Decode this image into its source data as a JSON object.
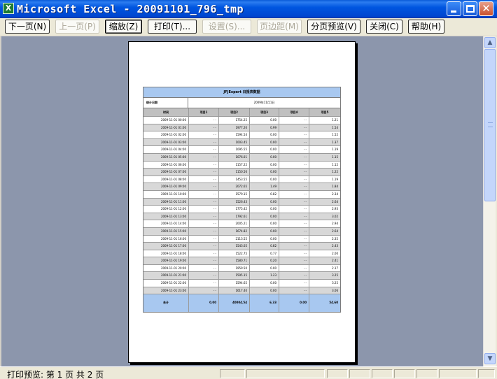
{
  "window": {
    "title": "Microsoft Excel - 20091101_796_tmp",
    "app_icon": "excel-icon",
    "controls": {
      "minimize": "minimize-icon",
      "maximize": "maximize-icon",
      "close": "✕"
    }
  },
  "toolbar": {
    "buttons": [
      {
        "label": "下一页(N)",
        "enabled": true
      },
      {
        "label": "上一页(P)",
        "enabled": false
      },
      {
        "label": "缩放(Z)",
        "enabled": true
      },
      {
        "label": "打印(T)...",
        "enabled": true
      },
      {
        "label": "设置(S)...",
        "enabled": false
      },
      {
        "label": "页边距(M)",
        "enabled": false
      },
      {
        "label": "分页预览(V)",
        "enabled": true
      },
      {
        "label": "关闭(C)",
        "enabled": true
      },
      {
        "label": "帮助(H)",
        "enabled": true
      }
    ]
  },
  "scrollbar": {
    "up": "▲",
    "down": "▼"
  },
  "report": {
    "title": "JFJExpert 日报表数据",
    "info_label": "统计日期",
    "info_value": "2009年11月1日",
    "headers": [
      "时间",
      "项目1",
      "项目2",
      "项目3",
      "项目4",
      "项目5"
    ],
    "rows": [
      [
        "2009-11-01 00:00",
        "- -",
        "1754.25",
        "0.00",
        "- -",
        "1.21"
      ],
      [
        "2009-11-01 01:00",
        "- -",
        "1977.20",
        "0.99",
        "- -",
        "1.54"
      ],
      [
        "2009-11-01 02:00",
        "- -",
        "1594.54",
        "0.00",
        "- -",
        "1.52"
      ],
      [
        "2009-11-01 03:00",
        "- -",
        "1003.45",
        "0.00",
        "- -",
        "1.37"
      ],
      [
        "2009-11-01 04:00",
        "- -",
        "1095.55",
        "0.00",
        "- -",
        "1.19"
      ],
      [
        "2009-11-01 05:00",
        "- -",
        "1076.01",
        "0.00",
        "- -",
        "1.15"
      ],
      [
        "2009-11-01 06:00",
        "- -",
        "1157.22",
        "0.00",
        "- -",
        "1.12"
      ],
      [
        "2009-11-01 07:00",
        "- -",
        "1150.56",
        "0.00",
        "- -",
        "1.22"
      ],
      [
        "2009-11-01 08:00",
        "- -",
        "1453.55",
        "0.00",
        "- -",
        "1.19"
      ],
      [
        "2009-11-01 09:00",
        "- -",
        "2072.65",
        "1.49",
        "- -",
        "1.84"
      ],
      [
        "2009-11-01 10:00",
        "- -",
        "1579.15",
        "0.82",
        "- -",
        "2.34"
      ],
      [
        "2009-11-01 11:00",
        "- -",
        "1526.43",
        "0.00",
        "- -",
        "2.64"
      ],
      [
        "2009-11-01 12:00",
        "- -",
        "1775.42",
        "0.00",
        "- -",
        "2.93"
      ],
      [
        "2009-11-01 13:00",
        "- -",
        "1792.61",
        "0.00",
        "- -",
        "3.02"
      ],
      [
        "2009-11-01 14:00",
        "- -",
        "2005.21",
        "0.00",
        "- -",
        "2.94"
      ],
      [
        "2009-11-01 15:00",
        "- -",
        "1674.82",
        "0.00",
        "- -",
        "2.64"
      ],
      [
        "2009-11-01 16:00",
        "- -",
        "2113.55",
        "0.00",
        "- -",
        "2.35"
      ],
      [
        "2009-11-01 17:00",
        "- -",
        "1543.05",
        "0.82",
        "- -",
        "2.43"
      ],
      [
        "2009-11-01 18:00",
        "- -",
        "1522.75",
        "0.77",
        "- -",
        "2.00"
      ],
      [
        "2009-11-01 19:00",
        "- -",
        "1580.71",
        "0.20",
        "- -",
        "2.41"
      ],
      [
        "2009-11-01 20:00",
        "- -",
        "1959.50",
        "0.00",
        "- -",
        "2.17"
      ],
      [
        "2009-11-01 21:00",
        "- -",
        "1595.15",
        "1.23",
        "- -",
        "3.25"
      ],
      [
        "2009-11-01 22:00",
        "- -",
        "1594.65",
        "0.00",
        "- -",
        "3.25"
      ],
      [
        "2009-11-01 23:00",
        "- -",
        "1617.40",
        "0.00",
        "- -",
        "3.06"
      ]
    ],
    "total": [
      "合计",
      "0.00",
      "40004.54",
      "6.33",
      "0.00",
      "54.60"
    ]
  },
  "status": {
    "text": "打印预览: 第 1 页  共 2 页"
  }
}
